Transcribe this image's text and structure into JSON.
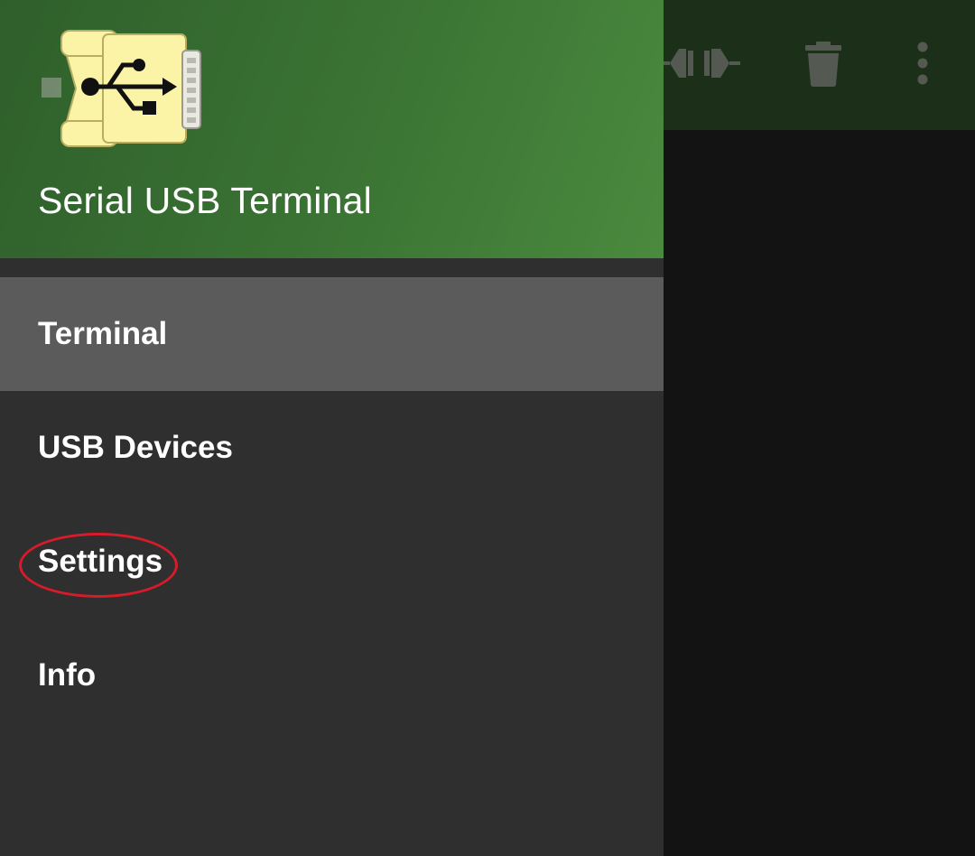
{
  "toolbar": {
    "actions": [
      {
        "icon": "connect-icon"
      },
      {
        "icon": "delete-icon"
      },
      {
        "icon": "more-vert-icon"
      }
    ],
    "background": "#1b2f19"
  },
  "drawer": {
    "header": {
      "logo_icon": "usb-serial-adapter-icon",
      "title": "Serial USB Terminal"
    },
    "items": [
      {
        "label": "Terminal",
        "active": true
      },
      {
        "label": "USB Devices",
        "active": false
      },
      {
        "label": "Settings",
        "active": false,
        "highlighted": true
      },
      {
        "label": "Info",
        "active": false
      }
    ]
  },
  "colors": {
    "header_green": "#3b7434",
    "drawer_bg": "#2f2f2f",
    "active_item_bg": "#5b5b5b",
    "highlight_ring": "#d81b2a"
  }
}
